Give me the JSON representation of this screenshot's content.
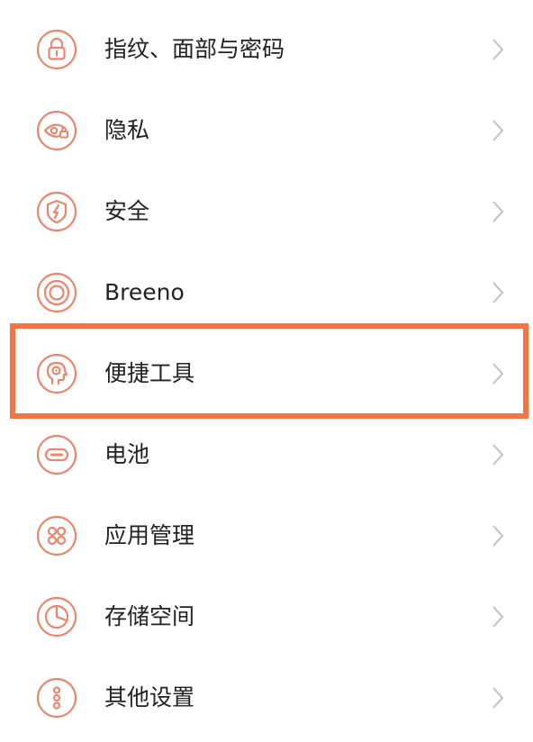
{
  "settings": {
    "items": [
      {
        "label": "指纹、面部与密码",
        "icon": "lock-icon"
      },
      {
        "label": "隐私",
        "icon": "eye-lock-icon"
      },
      {
        "label": "安全",
        "icon": "shield-bolt-icon"
      },
      {
        "label": "Breeno",
        "icon": "breeno-ring-icon"
      },
      {
        "label": "便捷工具",
        "icon": "head-gear-icon"
      },
      {
        "label": "电池",
        "icon": "battery-icon"
      },
      {
        "label": "应用管理",
        "icon": "app-grid-icon"
      },
      {
        "label": "存储空间",
        "icon": "pie-chart-icon"
      },
      {
        "label": "其他设置",
        "icon": "dots-icon"
      }
    ]
  },
  "colors": {
    "icon_accent": "#e9866d",
    "highlight_border": "#f47543",
    "label_text": "#222222",
    "chevron": "#c2c2c2"
  }
}
